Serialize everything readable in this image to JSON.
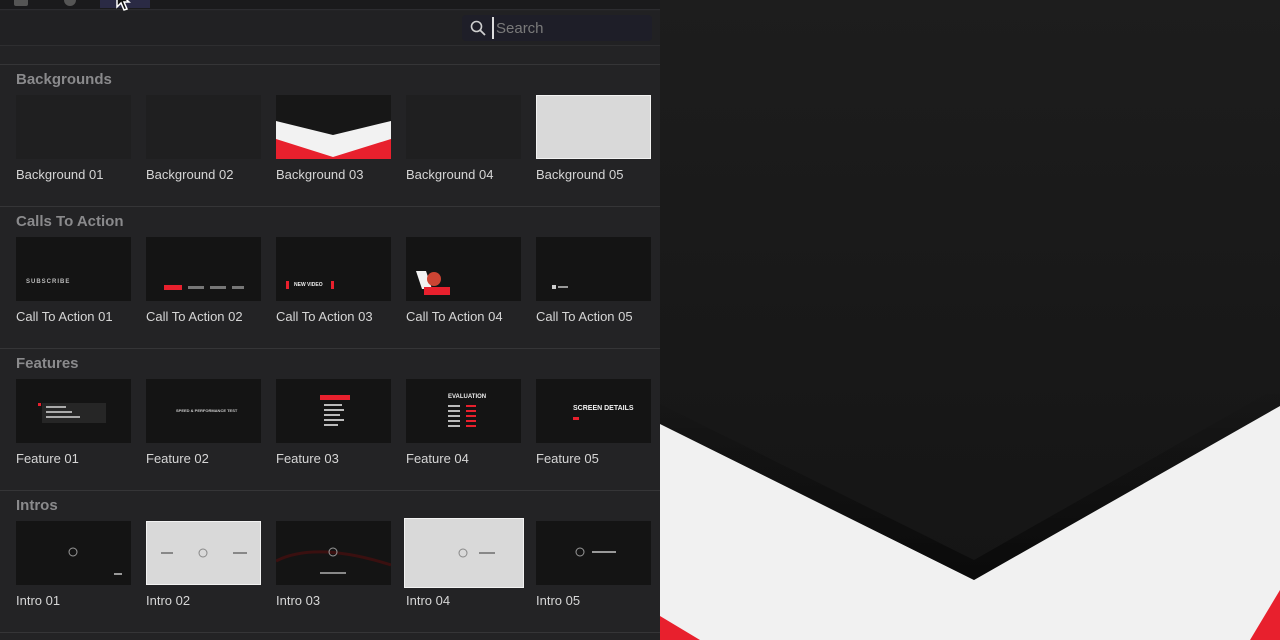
{
  "search": {
    "placeholder": "Search"
  },
  "sections": [
    {
      "title": "Backgrounds",
      "items": [
        {
          "label": "Background 01"
        },
        {
          "label": "Background 02"
        },
        {
          "label": "Background 03"
        },
        {
          "label": "Background 04"
        },
        {
          "label": "Background 05"
        }
      ]
    },
    {
      "title": "Calls To Action",
      "items": [
        {
          "label": "Call To Action 01",
          "thumb_text": "SUBSCRIBE"
        },
        {
          "label": "Call To Action 02"
        },
        {
          "label": "Call To Action 03",
          "thumb_text": "NEW VIDEO"
        },
        {
          "label": "Call To Action 04"
        },
        {
          "label": "Call To Action 05"
        }
      ]
    },
    {
      "title": "Features",
      "items": [
        {
          "label": "Feature 01"
        },
        {
          "label": "Feature 02",
          "thumb_text": "SPEED & PERFORMANCE TEST"
        },
        {
          "label": "Feature 03"
        },
        {
          "label": "Feature 04",
          "thumb_text": "EVALUATION"
        },
        {
          "label": "Feature 05",
          "thumb_text": "SCREEN DETAILS"
        }
      ]
    },
    {
      "title": "Intros",
      "items": [
        {
          "label": "Intro 01"
        },
        {
          "label": "Intro 02"
        },
        {
          "label": "Intro 03"
        },
        {
          "label": "Intro 04"
        },
        {
          "label": "Intro 05"
        }
      ]
    }
  ],
  "colors": {
    "accent": "#e8202d",
    "panel": "#232325",
    "preview_bg": "#1c1c1c",
    "light_tile": "#d9d9d9"
  },
  "icons": {
    "search": "magnifier-icon",
    "cursor": "arrow-cursor-icon"
  }
}
